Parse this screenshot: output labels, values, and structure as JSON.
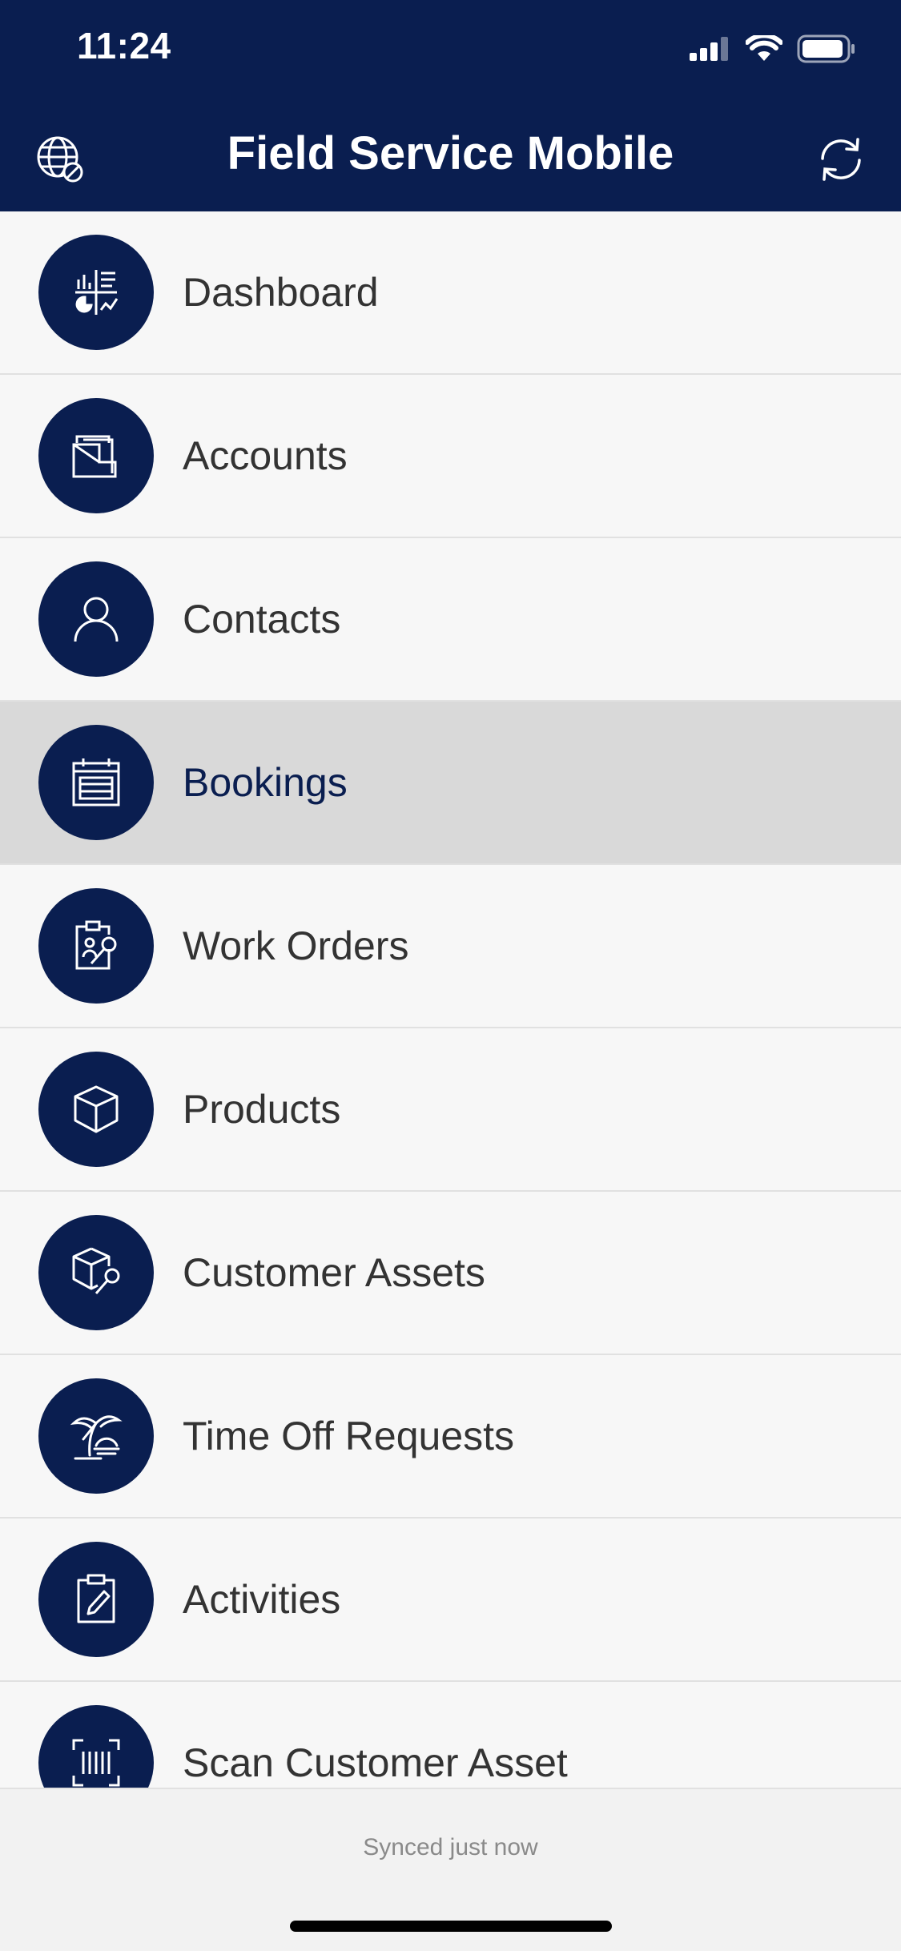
{
  "status_bar": {
    "time": "11:24"
  },
  "header": {
    "title": "Field Service Mobile",
    "left_icon": "globe-offline-icon",
    "right_icon": "sync-icon"
  },
  "menu": {
    "items": [
      {
        "label": "Dashboard",
        "icon": "dashboard-icon",
        "selected": false
      },
      {
        "label": "Accounts",
        "icon": "accounts-icon",
        "selected": false
      },
      {
        "label": "Contacts",
        "icon": "contact-person-icon",
        "selected": false
      },
      {
        "label": "Bookings",
        "icon": "calendar-icon",
        "selected": true
      },
      {
        "label": "Work Orders",
        "icon": "clipboard-wrench-icon",
        "selected": false
      },
      {
        "label": "Products",
        "icon": "box-icon",
        "selected": false
      },
      {
        "label": "Customer Assets",
        "icon": "box-wrench-icon",
        "selected": false
      },
      {
        "label": "Time Off Requests",
        "icon": "palm-tree-icon",
        "selected": false
      },
      {
        "label": "Activities",
        "icon": "clipboard-pencil-icon",
        "selected": false
      },
      {
        "label": "Scan Customer Asset",
        "icon": "barcode-scan-icon",
        "selected": false
      }
    ]
  },
  "footer": {
    "sync_status": "Synced just now"
  },
  "colors": {
    "brand": "#0a1e50",
    "selected_row": "#d9d9d9",
    "background": "#f7f7f7"
  }
}
